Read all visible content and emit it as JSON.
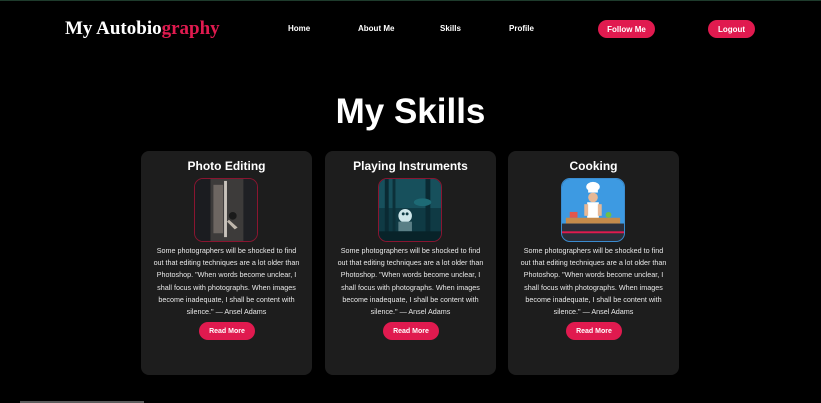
{
  "header": {
    "brand_prefix": "My Autobio",
    "brand_accent": "graphy",
    "nav": [
      "Home",
      "About Me",
      "Skills",
      "Profile"
    ],
    "follow_label": "Follow Me",
    "logout_label": "Logout"
  },
  "main": {
    "title": "My Skills",
    "cards": [
      {
        "title": "Photo Editing",
        "image_icon": "photo-editing-image",
        "text": "Some photographers will be shocked to find out that editing techniques are a lot older than Photoshop. \"When words become unclear, I shall focus with photographs. When images become inadequate, I shall be content with silence.\" — Ansel Adams",
        "button_label": "Read More"
      },
      {
        "title": "Playing Instruments",
        "image_icon": "instruments-image",
        "text": "Some photographers will be shocked to find out that editing techniques are a lot older than Photoshop. \"When words become unclear, I shall focus with photographs. When images become inadequate, I shall be content with silence.\" — Ansel Adams",
        "button_label": "Read More"
      },
      {
        "title": "Cooking",
        "image_icon": "cooking-image",
        "text": "Some photographers will be shocked to find out that editing techniques are a lot older than Photoshop. \"When words become unclear, I shall focus with photographs. When images become inadequate, I shall be content with silence.\" — Ansel Adams",
        "button_label": "Read More"
      }
    ]
  },
  "colors": {
    "background": "#000000",
    "card": "#1d1d1d",
    "accent": "#e01a4f",
    "text": "#ffffff"
  }
}
